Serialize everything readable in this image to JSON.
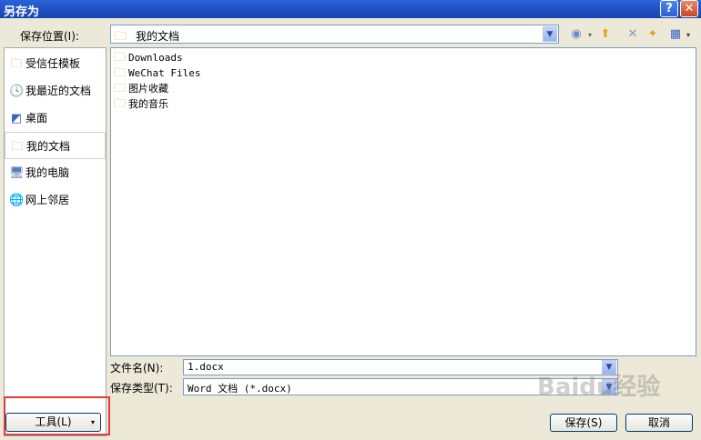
{
  "window": {
    "title": "另存为",
    "help_label": "?",
    "close_label": "✕"
  },
  "save_in": {
    "label": "保存位置(I):",
    "value": "我的文档"
  },
  "places": [
    {
      "label": "受信任模板",
      "icon": "templates-folder-icon"
    },
    {
      "label": "我最近的文档",
      "icon": "recent-documents-icon"
    },
    {
      "label": "桌面",
      "icon": "desktop-icon"
    },
    {
      "label": "我的文档",
      "icon": "my-documents-icon",
      "selected": true
    },
    {
      "label": "我的电脑",
      "icon": "my-computer-icon"
    },
    {
      "label": "网上邻居",
      "icon": "network-places-icon"
    }
  ],
  "files": [
    {
      "name": "Downloads",
      "icon": "folder-icon"
    },
    {
      "name": "WeChat Files",
      "icon": "folder-icon"
    },
    {
      "name": "图片收藏",
      "icon": "pictures-folder-icon"
    },
    {
      "name": "我的音乐",
      "icon": "music-folder-icon"
    }
  ],
  "filename": {
    "label": "文件名(N):",
    "value": "1.docx"
  },
  "filetype": {
    "label": "保存类型(T):",
    "value": "Word 文档 (*.docx)"
  },
  "buttons": {
    "tools": "工具(L)",
    "save": "保存(S)",
    "cancel": "取消"
  },
  "watermark": "Baidu经验"
}
